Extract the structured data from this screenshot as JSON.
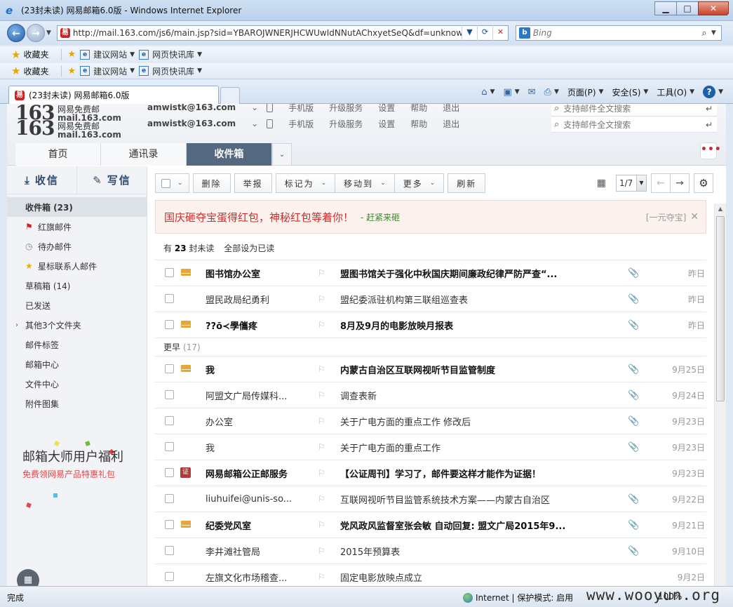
{
  "window": {
    "title": "(23封未读) 网易邮箱6.0版 - Windows Internet Explorer",
    "minimize": "▁",
    "maximize": "□",
    "close": "✕"
  },
  "address": {
    "url": "http://mail.163.com/js6/main.jsp?sid=YBAROJWNERJHCWUwIdNNutAChxyetSeQ&df=unknow",
    "search_placeholder": "Bing"
  },
  "favbar": {
    "favorites": "收藏夹",
    "suggested": "建议网站",
    "slices": "网页快讯库"
  },
  "ie_tab": {
    "title": "(23封未读) 网易邮箱6.0版"
  },
  "command_bar": {
    "page": "页面(P)",
    "safety": "安全(S)",
    "tools": "工具(O)"
  },
  "mail_header": {
    "logo_num": "163",
    "logo_cn": "网易免费邮",
    "logo_domain": "mail.163.com",
    "account": "amwistk@163.com",
    "links": [
      "手机版",
      "升级服务",
      "设置",
      "帮助",
      "退出"
    ],
    "search_placeholder": "支持邮件全文搜索"
  },
  "mail_tabs": {
    "home": "首页",
    "contacts": "通讯录",
    "inbox": "收件箱"
  },
  "sidebar": {
    "receive": "收信",
    "compose": "写信",
    "folders": [
      "收件箱 (23)",
      "红旗邮件",
      "待办邮件",
      "星标联系人邮件",
      "草稿箱 (14)",
      "已发送",
      "其他3个文件夹",
      "邮件标签",
      "邮箱中心",
      "文件中心",
      "附件图集"
    ],
    "promo_title": "邮箱大师用户福利",
    "promo_sub": "免费领网易产品特惠礼包"
  },
  "toolbar": {
    "delete": "删除",
    "report": "举报",
    "mark_as": "标记为",
    "move_to": "移动到",
    "more": "更多",
    "refresh": "刷新",
    "page": "1/7"
  },
  "banner": {
    "text": "国庆砸夺宝蛋得红包，神秘红包等着你！",
    "link": "- 赶紧来砸",
    "right": "[一元夺宝]"
  },
  "unread": {
    "prefix": "有",
    "count": "23",
    "suffix": "封未读",
    "mark_all": "全部设为已读"
  },
  "groups": {
    "earlier": "更早",
    "earlier_count": "(17)"
  },
  "mails_today": [
    {
      "sender": "图书馆办公室",
      "subject": "盟图书馆关于强化中秋国庆期间廉政纪律严防严查“...",
      "date": "昨日",
      "unread": true,
      "icon": "env",
      "clip": true
    },
    {
      "sender": "盟民政局纪勇利",
      "subject": "盟纪委派驻机构第三联组巡查表",
      "date": "昨日",
      "unread": false,
      "icon": "",
      "clip": true
    },
    {
      "sender": "??ō≺學儶疼",
      "subject": "8月及9月的电影放映月报表",
      "date": "昨日",
      "unread": true,
      "icon": "env",
      "clip": true
    }
  ],
  "mails_earlier": [
    {
      "sender": "我",
      "subject": "内蒙古自治区互联网视听节目监管制度",
      "date": "9月25日",
      "unread": true,
      "icon": "env",
      "clip": true
    },
    {
      "sender": "阿盟文广局传媒科...",
      "subject": "调查表新",
      "date": "9月24日",
      "unread": false,
      "icon": "",
      "clip": true
    },
    {
      "sender": "办公室",
      "subject": "关于广电方面的重点工作 修改后",
      "date": "9月23日",
      "unread": false,
      "icon": "",
      "clip": true
    },
    {
      "sender": "我",
      "subject": "关于广电方面的重点工作",
      "date": "9月23日",
      "unread": false,
      "icon": "",
      "clip": true
    },
    {
      "sender": "网易邮箱公正邮服务",
      "subject": "【公证周刊】学习了，邮件要这样才能作为证据！",
      "date": "9月23日",
      "unread": true,
      "icon": "cert",
      "clip": false
    },
    {
      "sender": "liuhuifei@unis-so...",
      "subject": "互联网视听节目监管系统技术方案——内蒙古自治区",
      "date": "9月22日",
      "unread": false,
      "icon": "",
      "clip": true
    },
    {
      "sender": "纪委党风室",
      "subject": "党风政风监督室张会敏 自动回复: 盟文广局2015年9...",
      "date": "9月21日",
      "unread": true,
      "icon": "env",
      "clip": true
    },
    {
      "sender": "李井滩社管局",
      "subject": "2015年预算表",
      "date": "9月10日",
      "unread": false,
      "icon": "",
      "clip": true
    },
    {
      "sender": "左旗文化市场稽查...",
      "subject": "固定电影放映点成立",
      "date": "9月2日",
      "unread": false,
      "icon": "",
      "clip": false
    }
  ],
  "cert_label": "证",
  "statusbar": {
    "done": "完成",
    "zone": "Internet | 保护模式: 启用",
    "zoom": "100%",
    "watermark": "www.wooyun.org"
  }
}
